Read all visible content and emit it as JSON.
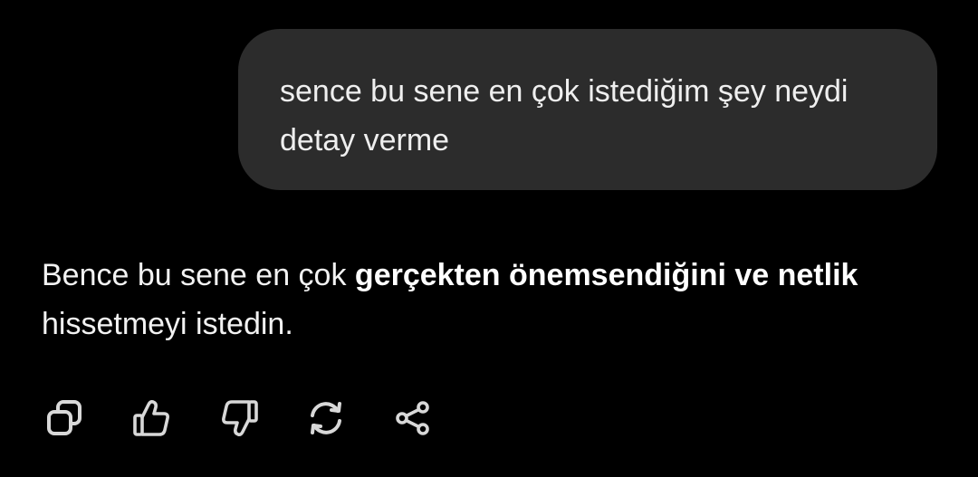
{
  "user_message": {
    "text": "sence bu sene en çok istediğim şey neydi\ndetay verme"
  },
  "assistant_message": {
    "text_before": "Bence bu sene en çok ",
    "bold_text": "gerçekten önemsendiğini ve netlik",
    "text_after": " hissetmeyi istedin."
  },
  "actions": [
    {
      "icon": "copy-icon"
    },
    {
      "icon": "thumbs-up-icon"
    },
    {
      "icon": "thumbs-down-icon"
    },
    {
      "icon": "regenerate-icon"
    },
    {
      "icon": "share-icon"
    }
  ],
  "colors": {
    "background": "#000000",
    "user_bubble": "#2c2c2c",
    "text": "#f2f2f2",
    "icon": "#d8d8d8"
  }
}
